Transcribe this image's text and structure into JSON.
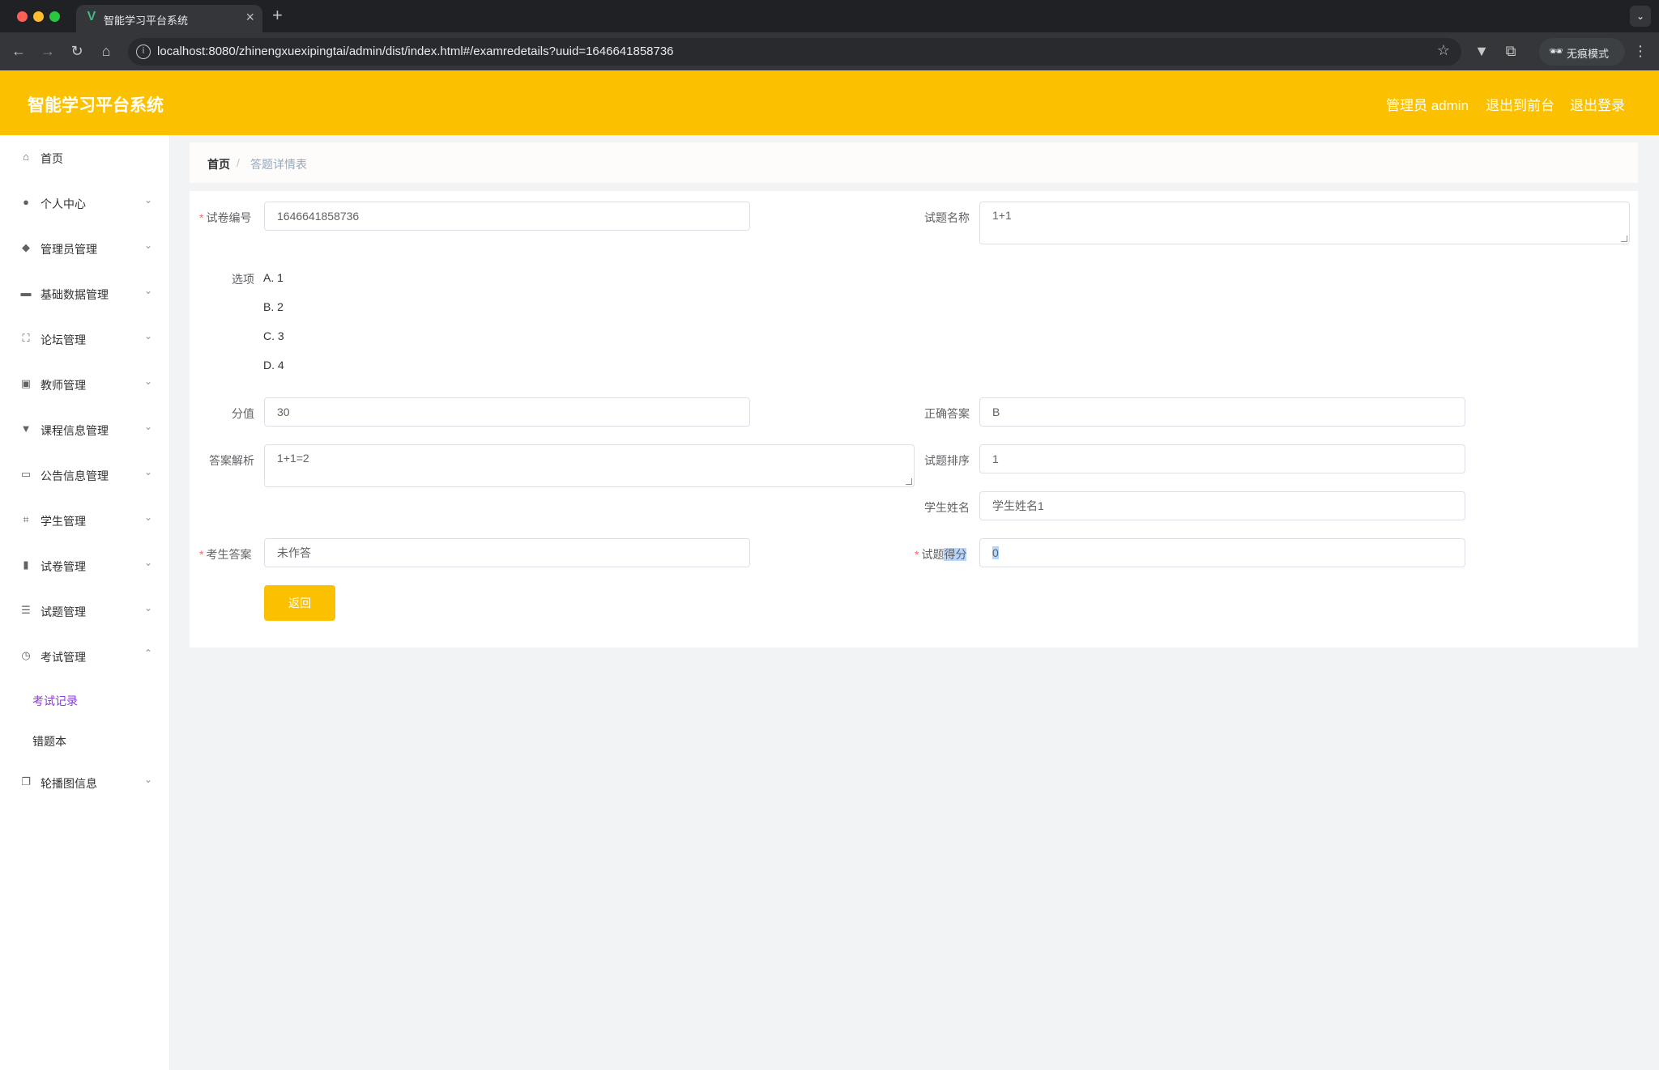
{
  "browser": {
    "tab_title": "智能学习平台系统",
    "tab_close": "×",
    "new_tab": "+",
    "tab_menu": "⌄",
    "url": "localhost:8080/zhinengxuexipingtai/admin/dist/index.html#/examredetails?uuid=1646641858736",
    "incognito_label": "无痕模式"
  },
  "header": {
    "title": "智能学习平台系统",
    "user": "管理员 admin",
    "to_front": "退出到前台",
    "logout": "退出登录"
  },
  "sidebar": {
    "items": [
      {
        "label": "首页",
        "icon": "home-icon"
      },
      {
        "label": "个人中心",
        "icon": "user-icon"
      },
      {
        "label": "管理员管理",
        "icon": "admin-icon"
      },
      {
        "label": "基础数据管理",
        "icon": "data-icon"
      },
      {
        "label": "论坛管理",
        "icon": "forum-icon"
      },
      {
        "label": "教师管理",
        "icon": "teacher-icon"
      },
      {
        "label": "课程信息管理",
        "icon": "course-icon"
      },
      {
        "label": "公告信息管理",
        "icon": "notice-icon"
      },
      {
        "label": "学生管理",
        "icon": "student-icon"
      },
      {
        "label": "试卷管理",
        "icon": "paper-icon"
      },
      {
        "label": "试题管理",
        "icon": "question-icon"
      },
      {
        "label": "考试管理",
        "icon": "exam-icon"
      },
      {
        "label": "轮播图信息",
        "icon": "carousel-icon"
      }
    ],
    "sub_items": [
      {
        "label": "考试记录"
      },
      {
        "label": "错题本"
      }
    ]
  },
  "breadcrumb": {
    "home": "首页",
    "separator": "/",
    "current": "答题详情表"
  },
  "form": {
    "paper_id_label": "试卷编号",
    "paper_id_value": "1646641858736",
    "question_name_label": "试题名称",
    "question_name_value": "1+1",
    "options_label": "选项",
    "options": [
      "A. 1",
      "B. 2",
      "C. 3",
      "D. 4"
    ],
    "score_label": "分值",
    "score_value": "30",
    "correct_answer_label": "正确答案",
    "correct_answer_value": "B",
    "analysis_label": "答案解析",
    "analysis_value": "1+1=2",
    "order_label": "试题排序",
    "order_value": "1",
    "student_name_label": "学生姓名",
    "student_name_value": "学生姓名1",
    "student_answer_label": "考生答案",
    "student_answer_value": "未作答",
    "question_score_label_a": "试题",
    "question_score_label_b": "得分",
    "question_score_value": "0",
    "required_mark": "*",
    "back_button": "返回"
  },
  "colors": {
    "accent": "#fbc100",
    "active_menu": "#8c3bdb",
    "required": "#f56c6c"
  }
}
